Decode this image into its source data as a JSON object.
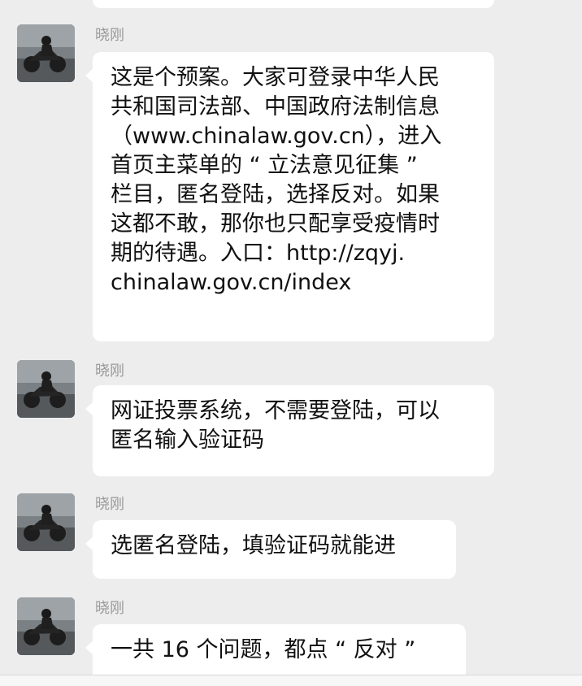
{
  "conversation": {
    "messages": [
      {
        "sender": "晓刚",
        "avatar_icon": "motorcycle-rider-avatar",
        "text": "这是个预案。大家可登录中华人民\n共和国司法部、中国政府法制信息\n（www.chinalaw.gov.cn），进入\n首页主菜单的 “ 立法意见征集 ”\n栏目，匿名登陆，选择反对。如果\n这都不敢，那你也只配享受疫情时\n期的待遇。入口：http://zqyj.\nchinalaw.gov.cn/index"
      },
      {
        "sender": "晓刚",
        "avatar_icon": "motorcycle-rider-avatar",
        "text": "网证投票系统，不需要登陆，可以\n匿名输入验证码"
      },
      {
        "sender": "晓刚",
        "avatar_icon": "motorcycle-rider-avatar",
        "text": "选匿名登陆，填验证码就能进"
      },
      {
        "sender": "晓刚",
        "avatar_icon": "motorcycle-rider-avatar",
        "text": "一共 16 个问题，都点 “ 反对 ”"
      }
    ]
  },
  "colors": {
    "background": "#ededed",
    "bubble": "#ffffff",
    "sender_text": "#9a9a9a",
    "message_text": "#111111"
  }
}
